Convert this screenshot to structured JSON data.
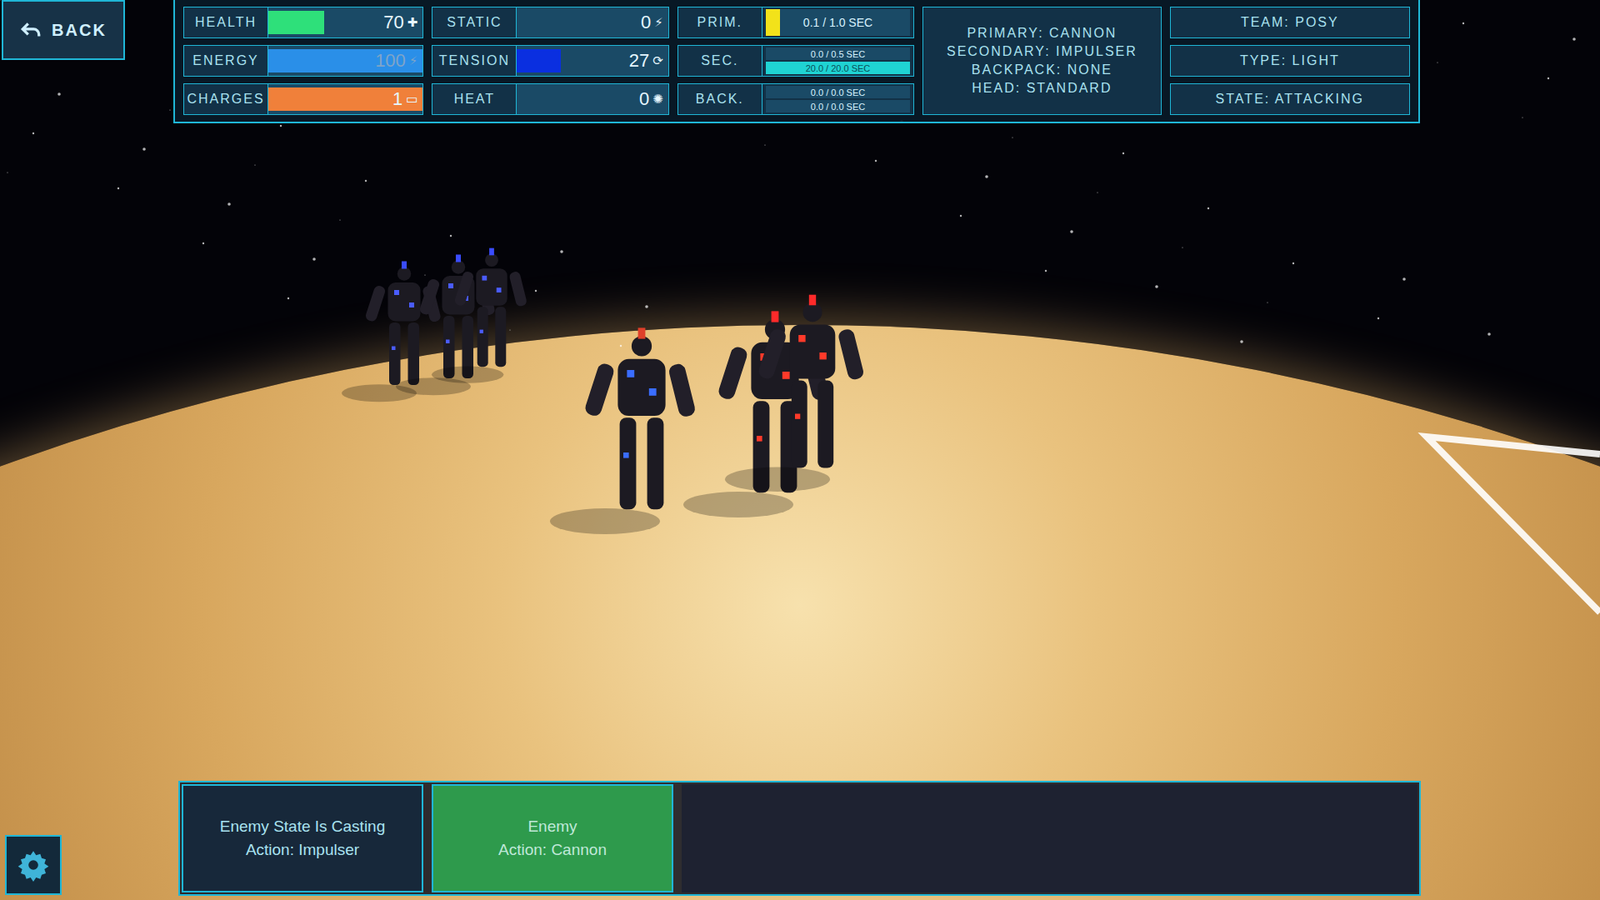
{
  "back_button": {
    "label": "BACK"
  },
  "stats": [
    {
      "label": "HEALTH",
      "value": "70",
      "level": 0.36,
      "color": "#2ee07a",
      "icon": "✚",
      "dim": false
    },
    {
      "label": "ENERGY",
      "value": "100",
      "level": 1,
      "color": "#2a8fe8",
      "icon": "⚡",
      "dim": true
    },
    {
      "label": "CHARGES",
      "value": "1",
      "level": 1,
      "color": "#f0803a",
      "icon": "▭",
      "dim": false
    }
  ],
  "status": [
    {
      "label": "STATIC",
      "value": "0",
      "level": 0,
      "color": "#1a56d6",
      "icon": "⚡"
    },
    {
      "label": "TENSION",
      "value": "27",
      "level": 0.29,
      "color": "#0a2fe0",
      "icon": "⟳"
    },
    {
      "label": "HEAT",
      "value": "0",
      "level": 0,
      "color": "#e05a1a",
      "icon": "✺"
    }
  ],
  "cooldowns": [
    {
      "label": "PRIM.",
      "bars": [
        {
          "reading": "0.1 / 1.0 SEC",
          "level": 0.1,
          "color": "#f2e21a"
        }
      ]
    },
    {
      "label": "SEC.",
      "bars": [
        {
          "reading": "0.0 / 0.5 SEC",
          "level": 0,
          "color": "#1fd3d3"
        },
        {
          "reading": "20.0 / 20.0 SEC",
          "level": 1,
          "color": "#1fd3d3"
        }
      ]
    },
    {
      "label": "BACK.",
      "bars": [
        {
          "reading": "0.0 / 0.0 SEC",
          "level": 0,
          "color": "#1fd3d3"
        },
        {
          "reading": "0.0 / 0.0 SEC",
          "level": 0,
          "color": "#1fd3d3"
        }
      ]
    }
  ],
  "loadout": [
    "PRIMARY: CANNON",
    "SECONDARY: IMPULSER",
    "BACKPACK: NONE",
    "HEAD: STANDARD"
  ],
  "info": [
    "TEAM: POSY",
    "TYPE: LIGHT",
    "STATE: ATTACKING"
  ],
  "actions": [
    {
      "lines": [
        "Enemy State Is Casting",
        "Action: Impulser"
      ],
      "selected": false
    },
    {
      "lines": [
        "Enemy",
        "Action: Cannon"
      ],
      "selected": true
    }
  ]
}
